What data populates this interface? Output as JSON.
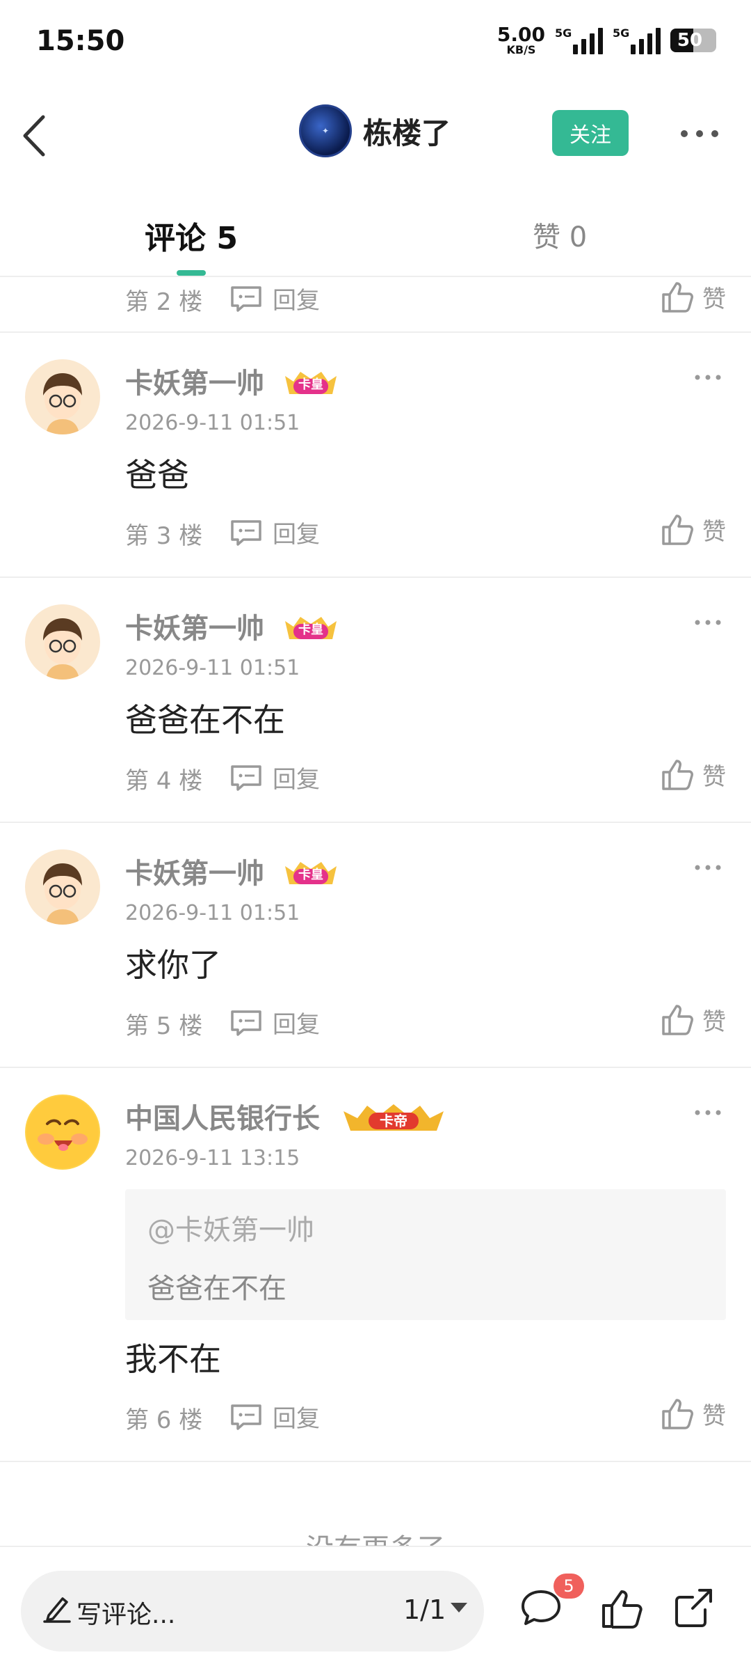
{
  "status": {
    "time": "15:50",
    "net_speed": "5.00",
    "net_unit": "KB/S",
    "sig1": "5G",
    "sig2": "5G",
    "battery": "50"
  },
  "header": {
    "author_name": "栋楼了",
    "follow_label": "关注"
  },
  "tabs": {
    "comments": "评论 5",
    "likes": "赞 0"
  },
  "partial": {
    "floor": "第 2 楼",
    "reply": "回复",
    "like": "赞"
  },
  "comments": [
    {
      "name": "卡妖第一帅",
      "badge": "卡皇",
      "time": "2026-9-11 01:51",
      "text": "爸爸",
      "floor": "第 3 楼",
      "reply": "回复",
      "like": "赞"
    },
    {
      "name": "卡妖第一帅",
      "badge": "卡皇",
      "time": "2026-9-11 01:51",
      "text": "爸爸在不在",
      "floor": "第 4 楼",
      "reply": "回复",
      "like": "赞"
    },
    {
      "name": "卡妖第一帅",
      "badge": "卡皇",
      "time": "2026-9-11 01:51",
      "text": "求你了",
      "floor": "第 5 楼",
      "reply": "回复",
      "like": "赞"
    },
    {
      "name": "中国人民银行长",
      "badge": "卡帝",
      "time": "2026-9-11 13:15",
      "quote_user": "@卡妖第一帅",
      "quote_text": "爸爸在不在",
      "text": "我不在",
      "floor": "第 6 楼",
      "reply": "回复",
      "like": "赞"
    }
  ],
  "no_more": "没有更多了",
  "bottom": {
    "placeholder": "写评论...",
    "page": "1/1",
    "comment_count": "5"
  },
  "colors": {
    "accent": "#34b994",
    "badge_red": "#f0605c"
  }
}
